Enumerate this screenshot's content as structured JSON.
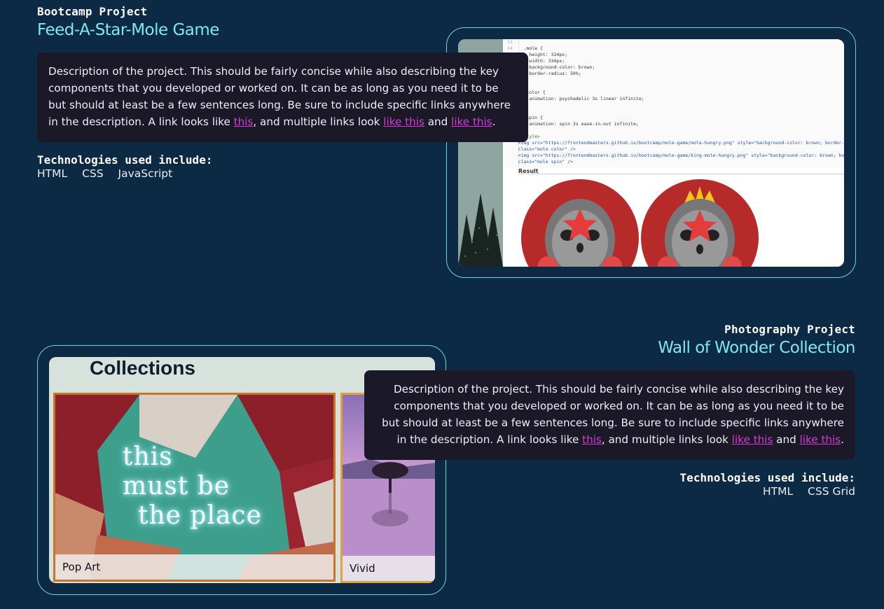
{
  "projects": [
    {
      "kicker": "Bootcamp Project",
      "title": "Feed-A-Star-Mole Game",
      "description": {
        "text_before": "Description of the project. This should be fairly concise while also describing the key components that you developed or worked on. It can be as long as you need it to be but should at least be a few sentences long. Be sure to include specific links anywhere in the description. A link looks like ",
        "link1": "this",
        "text_middle": ", and multiple links look ",
        "link2": "like this",
        "text_and": " and ",
        "link3": "like this",
        "text_end": "."
      },
      "tech_heading": "Technologies used include:",
      "technologies": [
        "HTML",
        "CSS",
        "JavaScript"
      ],
      "screenshot": {
        "code_lines": [
          {
            "n": "13",
            "t": ""
          },
          {
            "n": "14",
            "t": "  .mole {"
          },
          {
            "n": "",
            "t": "    height: 334px;"
          },
          {
            "n": "",
            "t": "    width: 334px;"
          },
          {
            "n": "",
            "t": "    background-color: brown;"
          },
          {
            "n": "",
            "t": "    border-radius: 50%;"
          },
          {
            "n": "",
            "t": "  }"
          },
          {
            "n": "",
            "t": ""
          },
          {
            "n": "",
            "t": "  .color {"
          },
          {
            "n": "",
            "t": "    animation: psychadelic 3s linear infinite;"
          },
          {
            "n": "",
            "t": "  }"
          },
          {
            "n": "",
            "t": ""
          },
          {
            "n": "",
            "t": "  .spin {"
          },
          {
            "n": "",
            "t": "    animation: spin 3s ease-in-out infinite;"
          },
          {
            "n": "",
            "t": "  }"
          }
        ],
        "style_close": "</style>",
        "img_line_1": "<img src=\"https://frontendmasters.github.io/bootcamp/mole-game/mole-hungry.png\" style=\"background-color: brown; border-radi",
        "img_class_1": "class=\"mole color\" />",
        "img_line_2": "<img src=\"https://frontendmasters.github.io/bootcamp/mole-game/king-mole-hungry.png\" style=\"background-color: brown; borde",
        "img_class_2": "class=\"mole spin\" />",
        "result_label": "Result"
      }
    },
    {
      "kicker": "Photography Project",
      "title": "Wall of Wonder Collection",
      "description": {
        "text_before": "Description of the project. This should be fairly concise while also describing the key components that you developed or worked on. It can be as long as you need it to be but should at least be a few sentences long. Be sure to include specific links anywhere in the description. A link looks like ",
        "link1": "this",
        "text_middle": ", and multiple links look ",
        "link2": "like this",
        "text_and": " and ",
        "link3": "like this",
        "text_end": "."
      },
      "tech_heading": "Technologies used include:",
      "technologies": [
        "HTML",
        "CSS Grid"
      ],
      "screenshot": {
        "heading": "Collections",
        "cards": [
          "Pop Art",
          "Vivid"
        ],
        "neon_lines": [
          "this",
          "must be",
          "the place"
        ]
      }
    }
  ],
  "colors": {
    "background": "#0d2a45",
    "title": "#7fe7ef",
    "card": "#1b1827",
    "link": "#d63bd6",
    "frame_border": "#6fd3d9"
  }
}
